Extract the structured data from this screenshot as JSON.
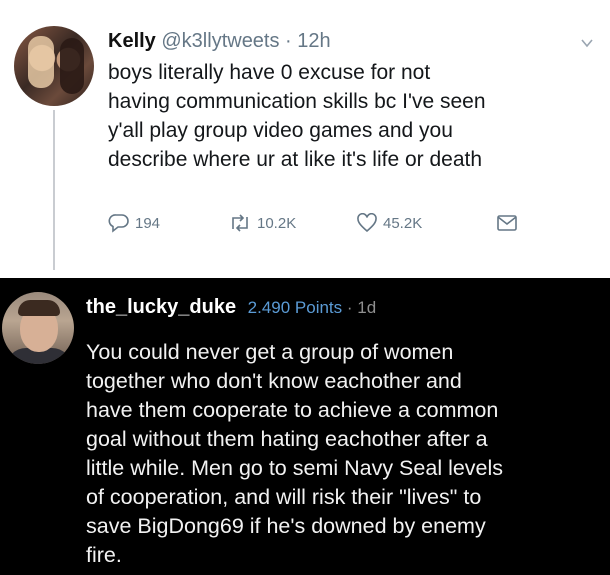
{
  "tweet": {
    "author_name": "Kelly",
    "author_handle": "@k3llytweets",
    "separator": " · ",
    "time": "12h",
    "text_lines": [
      "boys literally have 0 excuse for not",
      "having communication skills bc I've seen",
      "y'all play group video games and you",
      "describe where ur at like it's life or death"
    ],
    "actions": {
      "replies": "194",
      "retweets": "10.2K",
      "likes": "45.2K"
    },
    "icons": {
      "reply": "reply-icon",
      "retweet": "retweet-icon",
      "like": "heart-icon",
      "dm": "envelope-icon",
      "menu": "chevron-down-icon"
    },
    "colors": {
      "meta": "#657786",
      "text": "#14171a"
    }
  },
  "comment": {
    "username": "the_lucky_duke",
    "points": "2.490 Points",
    "separator": " · ",
    "age": "1d",
    "text_lines": [
      "You could never get a group of women",
      "together who don't know eachother and",
      "have them cooperate to achieve a common",
      "goal without them hating eachother after a",
      "little while. Men go to semi Navy Seal levels",
      "of cooperation, and will risk their \"lives\" to",
      "save BigDong69 if he's downed by enemy",
      "fire."
    ],
    "colors": {
      "background": "#000000",
      "points": "#5b9bd5",
      "text": "#f2f2f2"
    }
  }
}
